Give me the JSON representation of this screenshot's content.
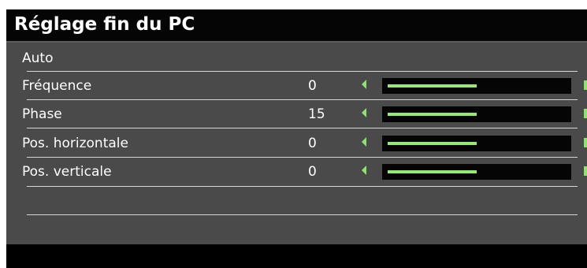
{
  "menu": {
    "title": "Réglage fin du PC",
    "auto_label": "Auto",
    "accent_color": "#8ee36b",
    "items": [
      {
        "label": "Fréquence",
        "value": "0",
        "level": 0.5
      },
      {
        "label": "Phase",
        "value": "15",
        "level": 0.5
      },
      {
        "label": "Pos. horizontale",
        "value": "0",
        "level": 0.5
      },
      {
        "label": "Pos. verticale",
        "value": "0",
        "level": 0.5
      }
    ]
  }
}
